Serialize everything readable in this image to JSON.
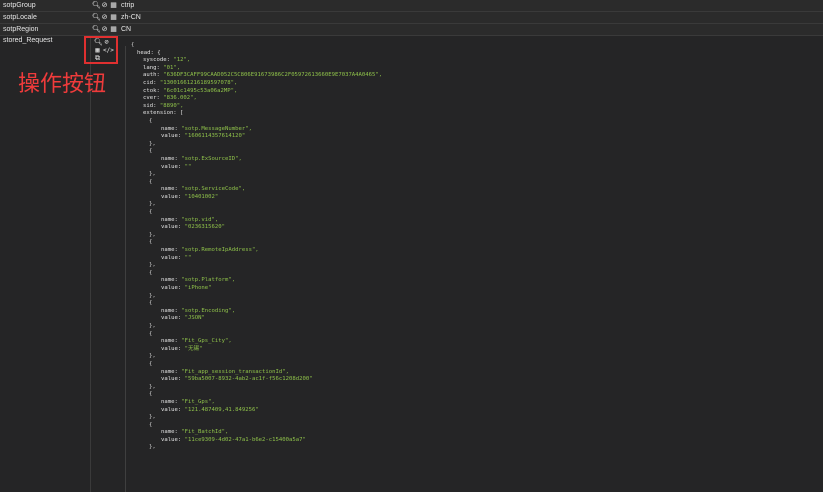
{
  "header_rows": [
    {
      "key": "sotpGroup",
      "value": "ctrip"
    },
    {
      "key": "sotpLocale",
      "value": "zh-CN"
    },
    {
      "key": "sotpRegion",
      "value": "CN"
    }
  ],
  "icons": {
    "search": "search-icon",
    "edit": "edit-icon",
    "grid": "grid-icon",
    "code": "code-icon",
    "copy": "copy-icon"
  },
  "stored_request": {
    "key": "stored_Request",
    "annotation": "操作按钮"
  },
  "json_tokens": {
    "open_brace": "{",
    "close_brace": "},",
    "close_brace_last": "}",
    "head_open": "head: {",
    "extension_open": "extension: ["
  },
  "json_head": [
    {
      "k": "syscode:",
      "v": "\"12\","
    },
    {
      "k": "lang:",
      "v": "\"01\","
    },
    {
      "k": "auth:",
      "v": "\"636DF3CAFF99CAAD052C5C806E91673986C2F05972613660E9E7037A4A0465\","
    },
    {
      "k": "cid:",
      "v": "\"13001661216189597078\","
    },
    {
      "k": "ctok:",
      "v": "\"6c01c1495c53a06a2MP\","
    },
    {
      "k": "cver:",
      "v": "\"836.002\","
    },
    {
      "k": "sid:",
      "v": "\"8890\","
    }
  ],
  "extension": [
    {
      "name": "\"sotp.MessageNumber\",",
      "value": "\"1606114357614120\""
    },
    {
      "name": "\"sotp.ExSourceID\",",
      "value": "\"\""
    },
    {
      "name": "\"sotp.ServiceCode\",",
      "value": "\"10401002\""
    },
    {
      "name": "\"sotp.vid\",",
      "value": "\"0236315620\""
    },
    {
      "name": "\"sotp.RemoteIpAddress\",",
      "value": "\"\""
    },
    {
      "name": "\"sotp.Platform\",",
      "value": "\"iPhone\""
    },
    {
      "name": "\"sotp.Encoding\",",
      "value": "\"JSON\""
    },
    {
      "name": "\"Fit_Gps_City\",",
      "value": "\"无锡\""
    },
    {
      "name": "\"Fit_app_session_transactionId\",",
      "value": "\"59ba5007-8932-4ab2-ac1f-f56c1208d200\""
    },
    {
      "name": "\"Fit_Gps\",",
      "value": "\"121.487409,41.849256\""
    },
    {
      "name": "\"Fit_BatchId\",",
      "value": "\"11ce9309-4d02-47a1-b6e2-c15400a5a7\""
    }
  ]
}
